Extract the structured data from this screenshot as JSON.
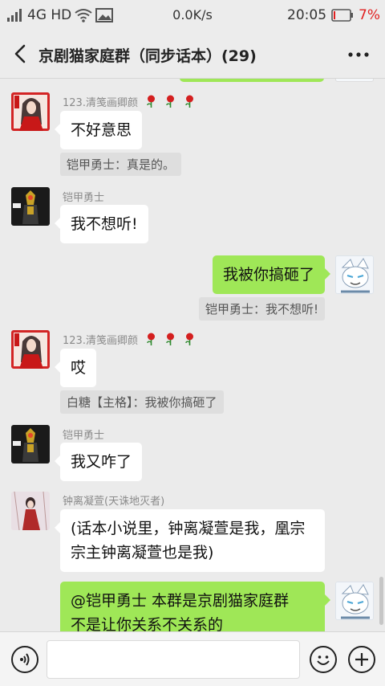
{
  "status": {
    "network": "4G HD",
    "speed": "0.0K/s",
    "time": "20:05",
    "battery": "7%"
  },
  "header": {
    "title": "京剧猫家庭群（同步话本）(29)"
  },
  "messages": {
    "m1": {
      "sender": "123.清笺画卿颜",
      "text": "不好意思",
      "quote": "铠甲勇士：真是的。"
    },
    "m2": {
      "sender": "铠甲勇士",
      "text": "我不想听!"
    },
    "m3": {
      "text": "我被你搞砸了",
      "quote": "铠甲勇士：我不想听!"
    },
    "m4": {
      "sender": "123.清笺画卿颜",
      "text": "哎",
      "quote": "白糖【主格】：我被你搞砸了"
    },
    "m5": {
      "sender": "铠甲勇士",
      "text": "我又咋了"
    },
    "m6": {
      "sender": "钟离凝萱(天诛地灭者)",
      "line1": "(话本小说里，钟离凝萱是我，凰宗",
      "line2": "宗主钟离凝萱也是我)"
    },
    "m7": {
      "line1": "@铠甲勇士  本群是京剧猫家庭群",
      "line2": "不是让你关系不关系的"
    }
  },
  "colors": {
    "self_bubble": "#9fe757",
    "other_bubble": "#ffffff",
    "chat_bg": "#ebebeb",
    "battery_low": "#e02020"
  },
  "icons": [
    "back-arrow-icon",
    "more-dots-icon",
    "rose-icon",
    "voice-icon",
    "emoji-icon",
    "plus-icon"
  ]
}
